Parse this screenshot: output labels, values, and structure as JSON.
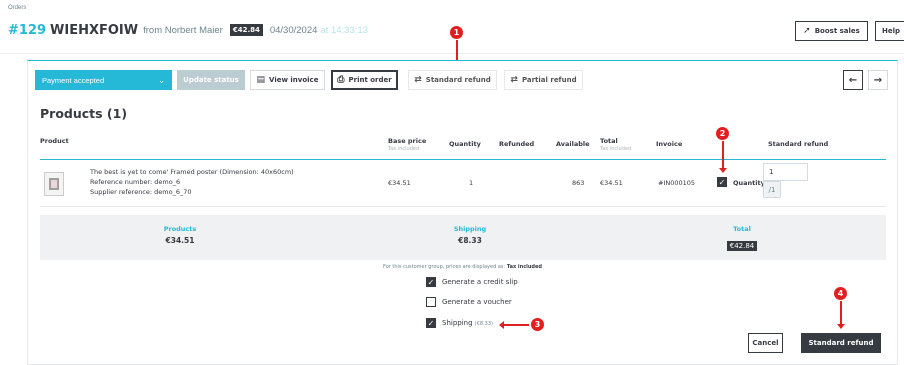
{
  "breadcrumb": "Orders",
  "order": {
    "number": "#129",
    "reference": "WIEHXFOIW",
    "from": "from Norbert Maier",
    "total_badge": "€42.84",
    "date": "04/30/2024",
    "time": "at 14:33:13"
  },
  "header_buttons": {
    "boost": "Boost sales",
    "help": "Help"
  },
  "toolbar": {
    "status": "Payment accepted",
    "update_status": "Update status",
    "view_invoice": "View invoice",
    "print_order": "Print order",
    "standard_refund": "Standard refund",
    "partial_refund": "Partial refund",
    "prev": "←",
    "next": "→"
  },
  "products_title": "Products (1)",
  "columns": {
    "product": "Product",
    "base_price": "Base price",
    "base_price_sub": "Tax included",
    "quantity": "Quantity",
    "refunded": "Refunded",
    "available": "Available",
    "total": "Total",
    "total_sub": "Tax included",
    "invoice": "Invoice",
    "standard_refund": "Standard refund"
  },
  "product_row": {
    "name": "The best is yet to come' Framed poster (Dimension: 40x60cm)",
    "reference": "Reference number: demo_6",
    "supplier_ref": "Supplier reference: demo_6_70",
    "base_price": "€34.51",
    "quantity": "1",
    "refunded": "",
    "available": "863",
    "total": "€34.51",
    "invoice": "#IN000105",
    "refund_qty_label": "Quantity",
    "refund_qty_value": "1",
    "refund_qty_max": "/1"
  },
  "summary": {
    "products_label": "Products",
    "products_value": "€34.51",
    "shipping_label": "Shipping",
    "shipping_value": "€8.33",
    "total_label": "Total",
    "total_value": "€42.84"
  },
  "tax_note": "For this customer group, prices are displayed as:",
  "tax_note_bold": "Tax included",
  "options": {
    "credit_slip": "Generate a credit slip",
    "voucher": "Generate a voucher",
    "shipping": "Shipping",
    "shipping_amount": "(€8.33)"
  },
  "actions": {
    "cancel": "Cancel",
    "submit": "Standard refund"
  },
  "markers": [
    "1",
    "2",
    "3",
    "4"
  ],
  "colors": {
    "accent": "#25b9d7",
    "dark": "#363a41",
    "annotation": "#e02020"
  }
}
